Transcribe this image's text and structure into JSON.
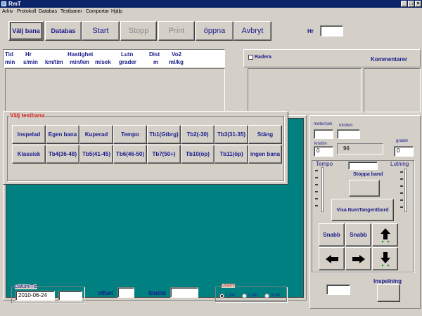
{
  "window": {
    "title": "RmT",
    "controls": [
      "_",
      "□",
      "×"
    ]
  },
  "menu": [
    "Arkiv",
    "Protokoll",
    "Databas",
    "Testbaner",
    "Comportar",
    "Hjälp"
  ],
  "toolbar": {
    "buttons": [
      {
        "label": "Välj bana",
        "enabled": true
      },
      {
        "label": "Databas",
        "enabled": true
      },
      {
        "label": "Start",
        "enabled": true
      },
      {
        "label": "Stopp",
        "enabled": false
      },
      {
        "label": "Print",
        "enabled": false
      },
      {
        "label": "öppna",
        "enabled": true
      },
      {
        "label": "Avbryt",
        "enabled": true
      }
    ],
    "hr_label": "Hr",
    "hr_value": ""
  },
  "grid_headers": {
    "row1": [
      "Tid",
      "Hr",
      "Hastighet",
      "Lutn",
      "Dist",
      "Vo2"
    ],
    "row2": [
      "min",
      "s/min",
      "km/tim",
      "min/km",
      "m/sek",
      "grader",
      "m",
      "ml/kg"
    ]
  },
  "right_top": {
    "radera_label": "Radera",
    "kommentarer_label": "Kommentarer"
  },
  "testbana_popup": {
    "title": "Välj testbana",
    "row1": [
      "Inspelad",
      "Egen bana",
      "Kuperad",
      "Tempo",
      "Tb1(Gtbrg)",
      "Tb2(-30)",
      "Tb3(31-35)",
      "Stäng"
    ],
    "row2": [
      "Klassisk",
      "Tb4(36-48)",
      "Tb5(41-45)",
      "Tb6(46-50)",
      "Tb7(50+)",
      "Tb10(öp)",
      "Tb11(öp)",
      "ingen bana"
    ]
  },
  "controls": {
    "meter_sek_label": "meter/sek",
    "min_km_label": "min/km",
    "km_tim_label": "km/tim",
    "km_tim_value": "0",
    "display_value": "96",
    "grader_label": "grader",
    "grader_value": "0",
    "tempo_label": "Tempo",
    "lutning_label": "Lutning",
    "stoppa_band_label": "Stoppa band",
    "visa_num_label": "Visa NumTangentbord",
    "snabb1_label": "Snabb",
    "snabb2_label": "Snabb",
    "inspelning_label": "Inspelning"
  },
  "bottom": {
    "datum_label": "Datum/Tid",
    "datum_value": "2010-06-24",
    "offset_label": "offset",
    "sluttid_label": "Sluttid",
    "utskrift_label": "Utskrift",
    "utskrift_options": [
      "1 pkt",
      "2 pkt",
      "3 pkt"
    ],
    "utskrift_selected": 0
  },
  "colors": {
    "teal_panel": "#008080",
    "title_bar": "#0a246a",
    "label_blue": "#1a1a8c",
    "group_title_red": "#d02020"
  }
}
